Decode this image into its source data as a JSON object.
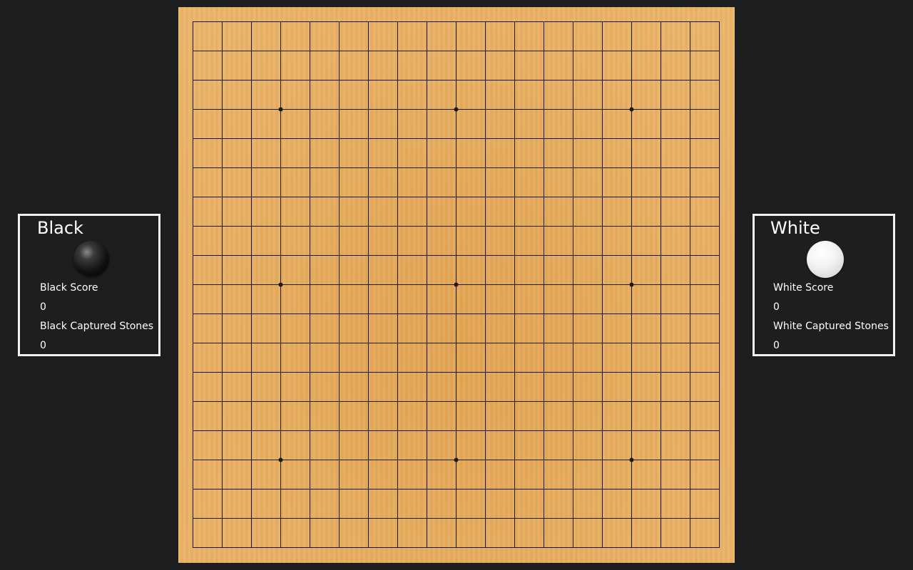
{
  "board": {
    "size": 19,
    "wood_color": "#e8ae60",
    "line_color": "#1a1a1a",
    "star_points": [
      [
        3,
        3
      ],
      [
        3,
        9
      ],
      [
        3,
        15
      ],
      [
        9,
        3
      ],
      [
        9,
        9
      ],
      [
        9,
        15
      ],
      [
        15,
        3
      ],
      [
        15,
        9
      ],
      [
        15,
        15
      ]
    ]
  },
  "black_panel": {
    "name": "Black",
    "stone_icon": "black-stone-icon",
    "score_label": "Black Score",
    "score_value": "0",
    "captured_label": "Black Captured Stones",
    "captured_value": "0"
  },
  "white_panel": {
    "name": "White",
    "stone_icon": "white-stone-icon",
    "score_label": "White Score",
    "score_value": "0",
    "captured_label": "White Captured Stones",
    "captured_value": "0"
  },
  "colors": {
    "background": "#1e1e1e",
    "panel_border": "#f2f2f2",
    "text": "#ffffff"
  }
}
